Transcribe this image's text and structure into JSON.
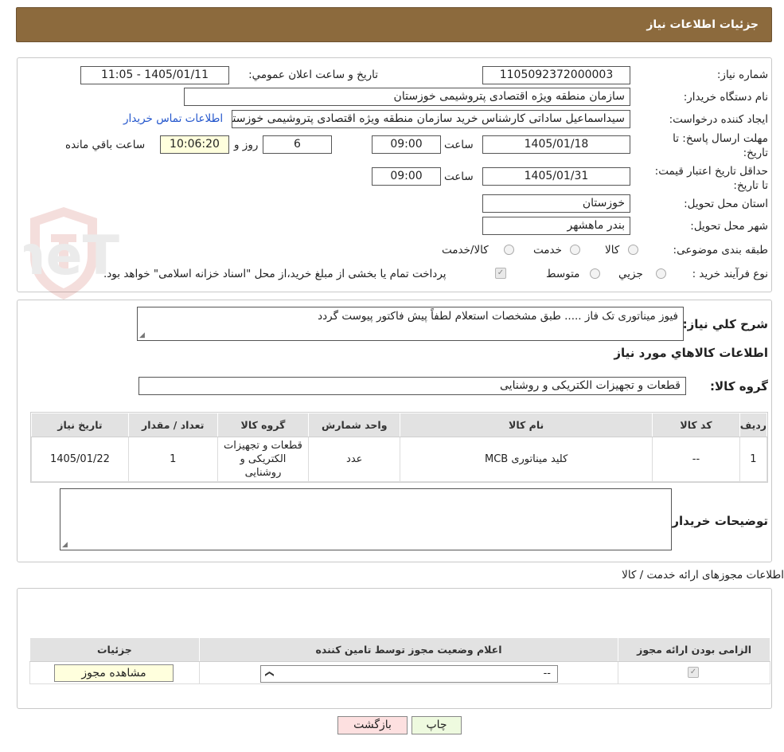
{
  "header": {
    "title": "جزئیات اطلاعات نیاز"
  },
  "form": {
    "need_number_label": "شماره نیاز:",
    "need_number": "1105092372000003",
    "announce_label": "تاریخ و ساعت اعلان عمومي:",
    "announce_value": "1405/01/11 - 11:05",
    "buyer_org_label": "نام دستگاه خريدار:",
    "buyer_org": "سازمان منطقه ویژه اقتصادی پتروشیمی خوزستان",
    "creator_label": "ايجاد كننده درخواست:",
    "creator": "سیداسماعیل ساداتی کارشناس خرید سازمان منطقه ویژه اقتصادی پتروشیمی خوزستان",
    "contact_link": "اطلاعات تماس خريدار",
    "reply_deadline_label": "مهلت ارسال پاسخ: تا تاریخ:",
    "reply_date": "1405/01/18",
    "time_label": "ساعت",
    "reply_time": "09:00",
    "days_value": "6",
    "days_label": "روز و",
    "remaining_time": "10:06:20",
    "remaining_label": "ساعت باقي مانده",
    "price_validity_label": "حداقل تاریخ اعتبار قیمت: تا تاریخ:",
    "price_date": "1405/01/31",
    "price_time": "09:00",
    "province_label": "استان محل تحويل:",
    "province": "خوزستان",
    "city_label": "شهر محل تحويل:",
    "city": "بندر ماهشهر",
    "category_label": "طبقه بندی موضوعی:",
    "category_options": [
      "کالا",
      "خدمت",
      "کالا/خدمت"
    ],
    "process_label": "نوع فرآيند خريد :",
    "process_options": [
      "جزيي",
      "متوسط"
    ],
    "treasury_note": "پرداخت تمام یا بخشی از مبلغ خرید،از محل \"اسناد خزانه اسلامی\" خواهد بود."
  },
  "details": {
    "desc_label": "شرح كلي نياز:",
    "desc_text": "فیوز میناتوری تک فاز ..... طبق مشخصات استعلام لطفاً پیش فاکتور پیوست گردد",
    "goods_info_title": "اطلاعات كالاهاي مورد نياز",
    "goods_group_label": "گروه كالا:",
    "goods_group": "قطعات و تجهیزات الکتریکی و روشنایی",
    "table": {
      "headers": [
        "رديف",
        "كد كالا",
        "نام كالا",
        "واحد شمارش",
        "گروه كالا",
        "تعداد / مقدار",
        "تاريخ نياز"
      ],
      "rows": [
        [
          "1",
          "--",
          "کلید میناتوری MCB",
          "عدد",
          "قطعات و تجهیزات الکتریکی و روشنایی",
          "1",
          "1405/01/22"
        ]
      ]
    },
    "buyer_notes_label": "توضيحات خريدار:"
  },
  "permits": {
    "title": "اطلاعات مجوزهای ارائه خدمت / کالا",
    "headers": [
      "الزامی بودن ارائه مجوز",
      "اعلام وضعیت مجوز توسط تامین کننده",
      "جزئیات"
    ],
    "select_value": "--",
    "view_button": "مشاهده مجوز"
  },
  "actions": {
    "print": "چاپ",
    "back": "بازگشت"
  },
  "watermark": "AriaTender.neT",
  "colors": {
    "header": "#8c6a3d",
    "link": "#2255cc",
    "back_button": "#fde0e0",
    "print_button": "#eefadf"
  }
}
